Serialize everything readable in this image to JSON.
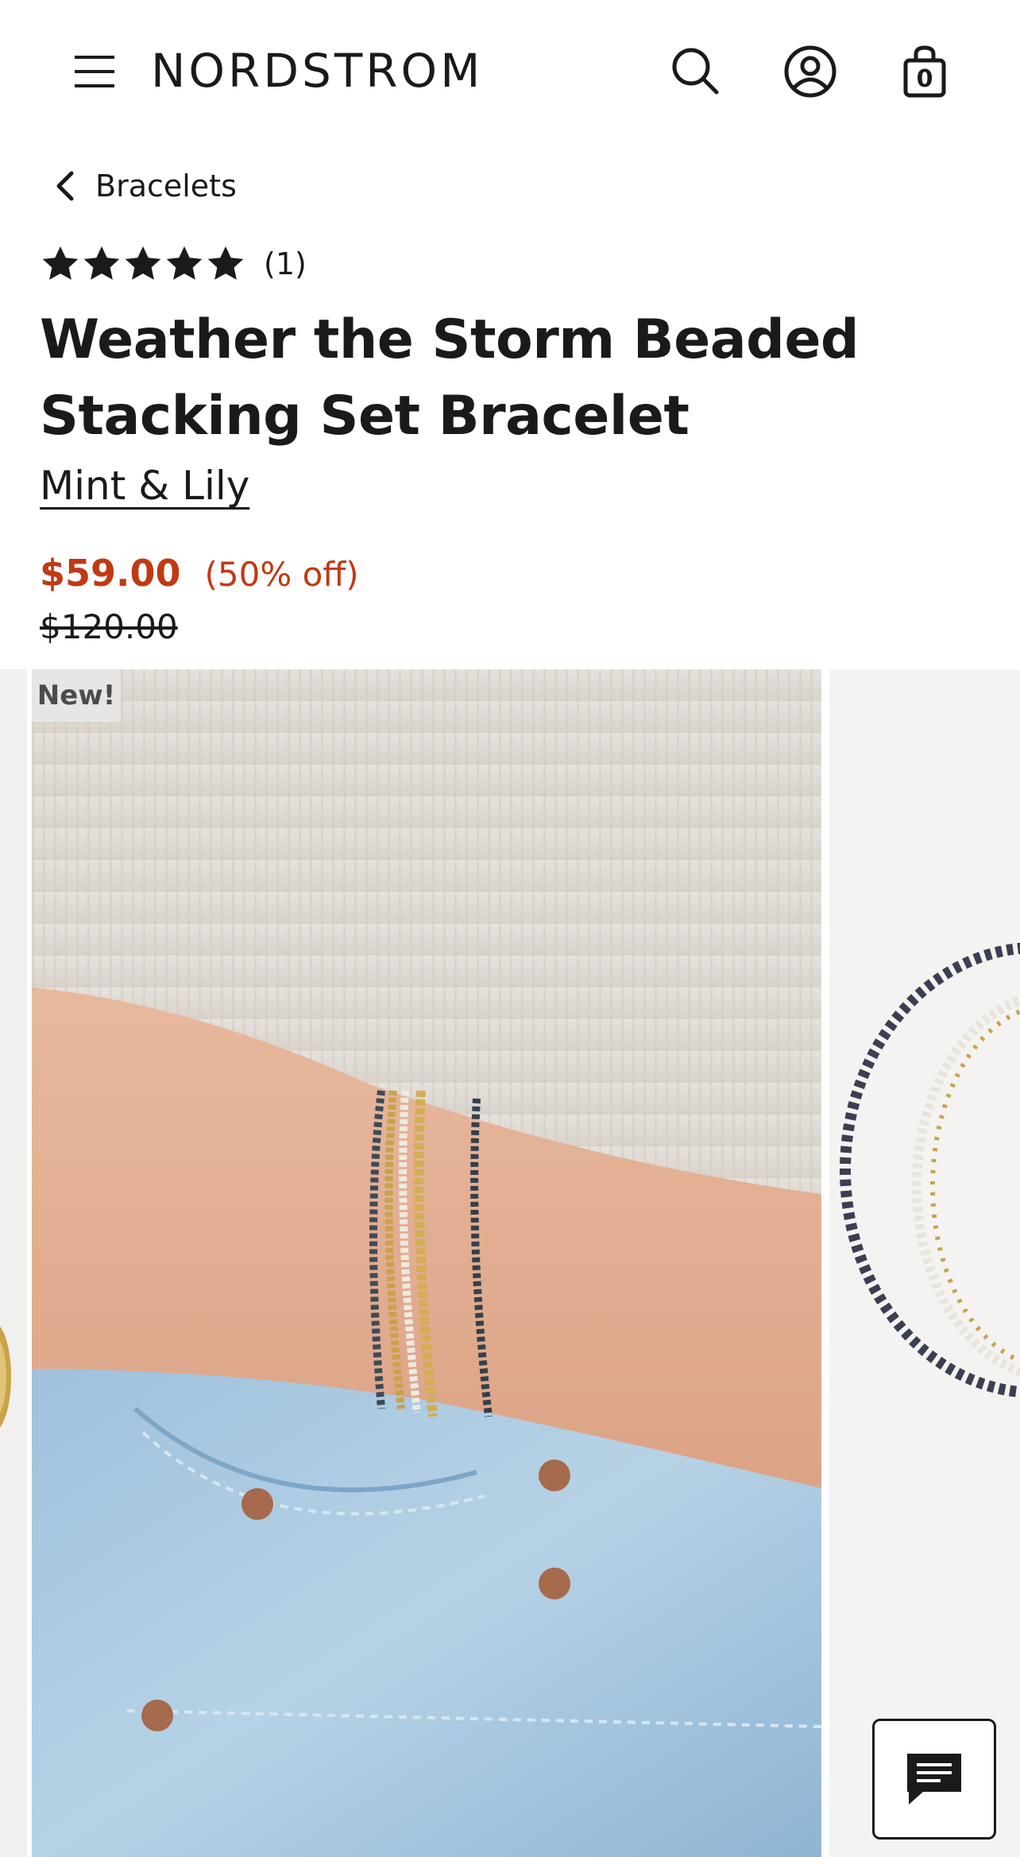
{
  "header": {
    "logo": "NORDSTROM",
    "bag_count": "0"
  },
  "breadcrumb": {
    "label": "Bracelets"
  },
  "product": {
    "rating": {
      "stars": 5,
      "max_stars": 5,
      "count_label": "(1)"
    },
    "title": "Weather the Storm Beaded Stacking Set Bracelet",
    "brand": "Mint & Lily",
    "sale_price": "$59.00",
    "discount": "(50% off)",
    "original_price": "$120.00"
  },
  "gallery": {
    "badge": "New!"
  },
  "colors": {
    "text": "#191a1b",
    "sale": "#c03a13",
    "badge_bg": "#e7e6e4"
  }
}
